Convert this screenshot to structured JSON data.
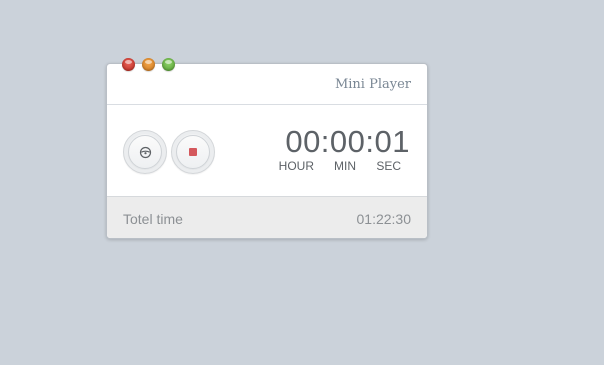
{
  "window": {
    "title": "Mini Player"
  },
  "icons": {
    "play": "steering-wheel-icon",
    "stop": "stop-icon"
  },
  "timer": {
    "display": "00:00:01",
    "labels": {
      "hour": "HOUR",
      "min": "MIN",
      "sec": "SEC"
    }
  },
  "footer": {
    "label": "Totel time",
    "value": "01:22:30"
  },
  "colors": {
    "background": "#cbd2da",
    "close": "#d2453b",
    "minimize": "#e89434",
    "zoom": "#6bbf45",
    "stop_accent": "#d4585c"
  }
}
